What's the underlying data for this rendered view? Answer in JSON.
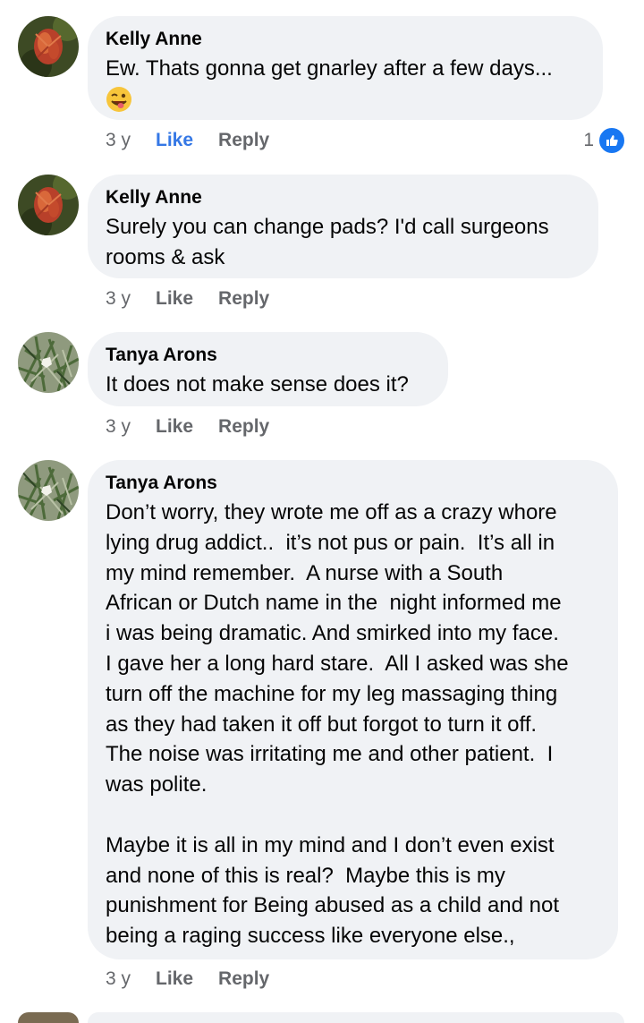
{
  "comments": [
    {
      "author": "Kelly Anne",
      "text": "Ew. Thats gonna get gnarley after a few days...",
      "emoji": "winking-face-with-tongue-icon",
      "time": "3 y",
      "like_label": "Like",
      "reply_label": "Reply",
      "liked": true,
      "reaction_count": "1"
    },
    {
      "author": "Kelly Anne",
      "text": "Surely you can change pads? I'd call surgeons\nrooms & ask",
      "time": "3 y",
      "like_label": "Like",
      "reply_label": "Reply"
    },
    {
      "author": "Tanya Arons",
      "text": "It does not make sense does it?",
      "time": "3 y",
      "like_label": "Like",
      "reply_label": "Reply"
    },
    {
      "author": "Tanya Arons",
      "text": "Don’t worry, they wrote me off as a crazy whore\nlying drug addict..  it’s not pus or pain.  It’s all in\nmy mind remember.  A nurse with a South\nAfrican or Dutch name in the  night informed me\ni was being dramatic. And smirked into my face.\nI gave her a long hard stare.  All I asked was she\nturn off the machine for my leg massaging thing\nas they had taken it off but forgot to turn it off.\nThe noise was irritating me and other patient.  I\nwas polite.\n\nMaybe it is all in my mind and I don’t even exist\nand none of this is real?  Maybe this is my\npunishment for Being abused as a child and not\nbeing a raging success like everyone else.,",
      "time": "3 y",
      "like_label": "Like",
      "reply_label": "Reply"
    }
  ],
  "colors": {
    "bubble": "#f0f2f5",
    "meta": "#65676b",
    "like_active": "#3578e5",
    "reaction_badge": "#1877f2"
  }
}
